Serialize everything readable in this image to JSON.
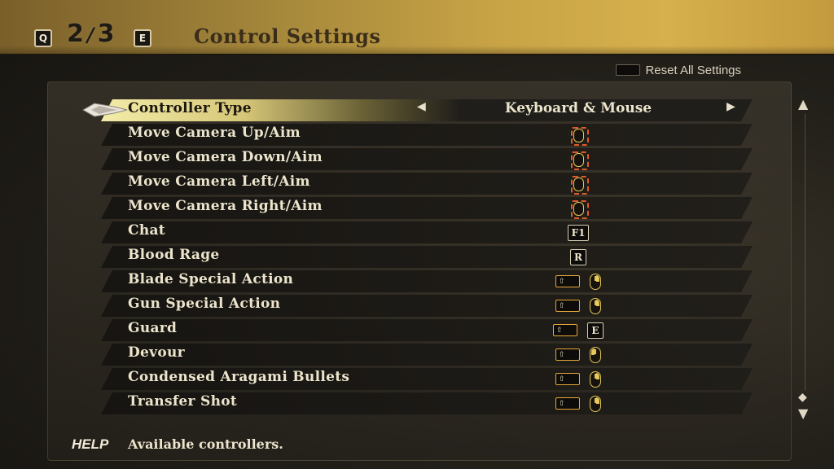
{
  "header": {
    "prev_key": "Q",
    "next_key": "E",
    "page_current": "2",
    "page_total": "3",
    "title": "Control Settings"
  },
  "reset": {
    "label": "Reset All Settings"
  },
  "controller_type": {
    "label": "Controller Type",
    "value": "Keyboard & Mouse",
    "left_arrow": "◀",
    "right_arrow": "▶"
  },
  "rows": [
    {
      "label": "Move Camera Up/Aim",
      "keys": [
        "mouse-move"
      ]
    },
    {
      "label": "Move Camera Down/Aim",
      "keys": [
        "mouse-move"
      ]
    },
    {
      "label": "Move Camera Left/Aim",
      "keys": [
        "mouse-move"
      ]
    },
    {
      "label": "Move Camera Right/Aim",
      "keys": [
        "mouse-move"
      ]
    },
    {
      "label": "Chat",
      "keys": [
        "F1"
      ]
    },
    {
      "label": "Blood Rage",
      "keys": [
        "R"
      ]
    },
    {
      "label": "Blade Special Action",
      "keys": [
        "shift",
        "mouse-right"
      ]
    },
    {
      "label": "Gun Special Action",
      "keys": [
        "shift",
        "mouse-right"
      ]
    },
    {
      "label": "Guard",
      "keys": [
        "shift",
        "E"
      ]
    },
    {
      "label": "Devour",
      "keys": [
        "shift",
        "mouse-left"
      ]
    },
    {
      "label": "Condensed Aragami Bullets",
      "keys": [
        "shift",
        "mouse-right"
      ]
    },
    {
      "label": "Transfer Shot",
      "keys": [
        "shift",
        "mouse-right"
      ]
    }
  ],
  "scrollbar": {
    "up": "▲",
    "thumb": "◆",
    "down": "▼"
  },
  "help": {
    "tag": "HELP",
    "text": "Available controllers."
  },
  "colors": {
    "accent": "#d6b04c",
    "key_border": "#e6c85a",
    "mouse_move_outline": "#e05a28"
  }
}
